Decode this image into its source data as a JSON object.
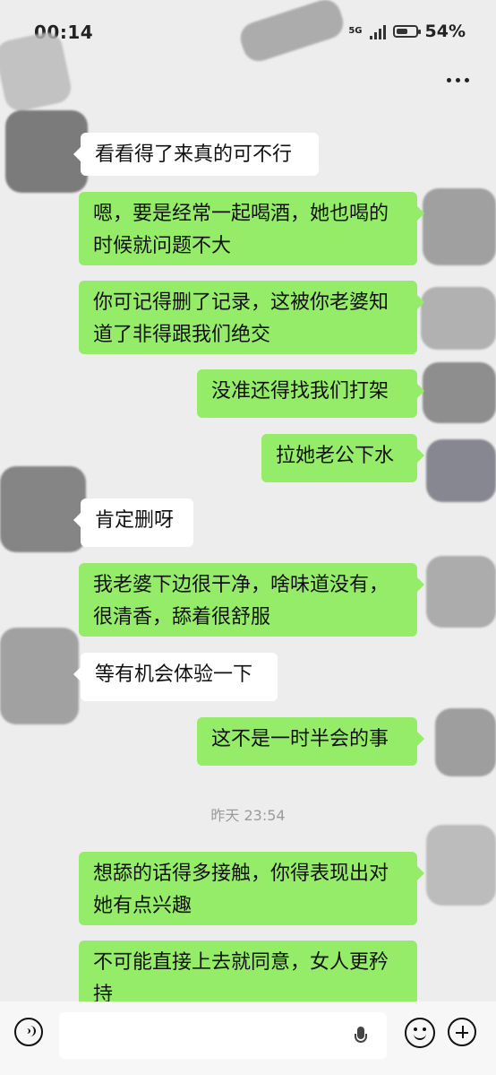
{
  "status_bar": {
    "time": "00:14",
    "network": "5G",
    "battery": "54%"
  },
  "chat": {
    "messages": [
      {
        "text": "看看得了来真的可不行"
      },
      {
        "text": "嗯，要是经常一起喝酒，她也喝的\n时候就问题不大"
      },
      {
        "text": "你可记得删了记录，这被你老婆知\n道了非得跟我们绝交"
      },
      {
        "text": "没准还得找我们打架"
      },
      {
        "text": "拉她老公下水"
      },
      {
        "text": "肯定删呀"
      },
      {
        "text": "我老婆下边很干净，啥味道没有，\n很清香，舔着很舒服"
      },
      {
        "text": "等有机会体验一下"
      },
      {
        "text": "这不是一时半会的事"
      },
      {
        "text": "想舔的话得多接触，你得表现出对\n她有点兴趣"
      },
      {
        "text": "不可能直接上去就同意，女人更矜\n持"
      }
    ],
    "timestamp": "昨天 23:54"
  },
  "icons": {
    "more": "more-icon",
    "voice": "voice-icon",
    "mic": "mic-icon",
    "emoji": "emoji-icon",
    "plus": "plus-icon"
  },
  "colors": {
    "background": "#ededed",
    "incoming_bubble": "#ffffff",
    "outgoing_bubble": "#95ec69"
  }
}
